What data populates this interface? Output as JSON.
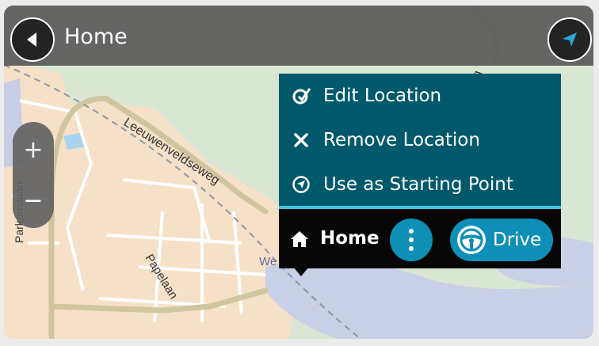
{
  "header": {
    "title": "Home"
  },
  "map": {
    "streets": [
      "Leeuwenveldseweg",
      "Papelaan",
      "Parkpuslaan"
    ],
    "fragments": [
      "eg",
      "We"
    ]
  },
  "zoom": {
    "in_label": "+",
    "out_label": "−"
  },
  "menu": {
    "items": [
      {
        "label": "Edit Location",
        "icon": "edit-location-icon"
      },
      {
        "label": "Remove Location",
        "icon": "close-icon"
      },
      {
        "label": "Use as Starting Point",
        "icon": "start-point-icon"
      }
    ]
  },
  "bottom": {
    "home_label": "Home",
    "drive_label": "Drive"
  },
  "colors": {
    "menu_bg": "#00596b",
    "separator": "#3fc4e0",
    "button_blue": "#0e8fb6",
    "bar_bg": "#060606"
  }
}
